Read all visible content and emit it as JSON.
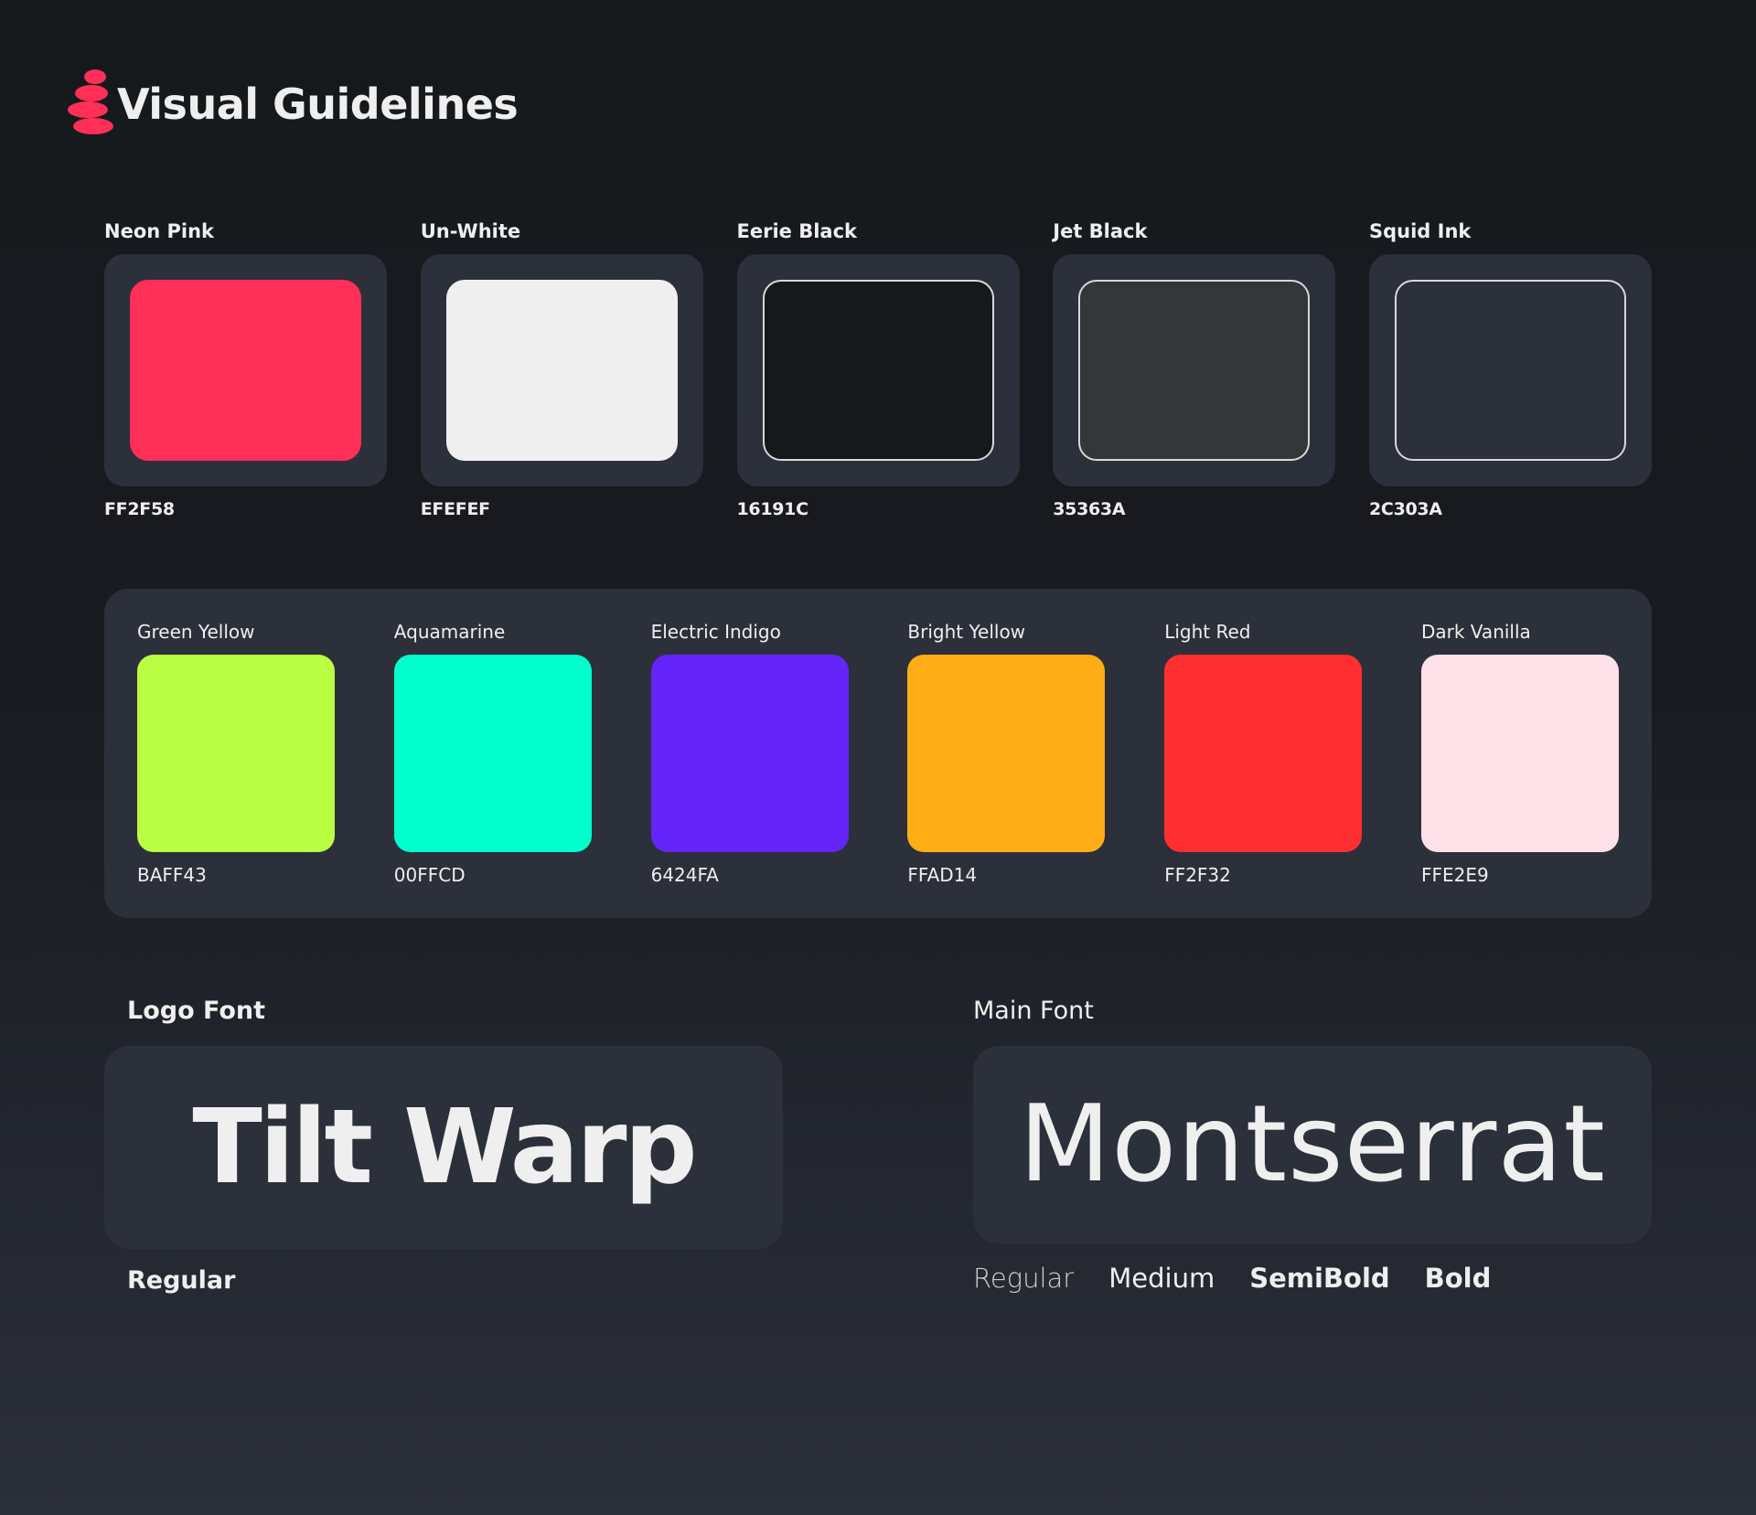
{
  "header": {
    "title": "Visual Guidelines",
    "logo_icon": "stacked-pebbles-icon",
    "accent": "#FF2F58"
  },
  "primary_colors": [
    {
      "name": "Neon Pink",
      "hex": "FF2F58",
      "color": "#FF2F58",
      "outlined": false
    },
    {
      "name": "Un-White",
      "hex": "EFEFEF",
      "color": "#EFEFEF",
      "outlined": false
    },
    {
      "name": "Eerie Black",
      "hex": "16191C",
      "color": "#16191C",
      "outlined": true
    },
    {
      "name": "Jet Black",
      "hex": "35363A",
      "color": "#35363A",
      "outlined": true
    },
    {
      "name": "Squid Ink",
      "hex": "2C303A",
      "color": "#2C303A",
      "outlined": true
    }
  ],
  "secondary_colors": [
    {
      "name": "Green Yellow",
      "hex": "BAFF43",
      "color": "#BAFF43"
    },
    {
      "name": "Aquamarine",
      "hex": "00FFCD",
      "color": "#00FFCD"
    },
    {
      "name": "Electric Indigo",
      "hex": "6424FA",
      "color": "#6424FA"
    },
    {
      "name": "Bright Yellow",
      "hex": "FFAD14",
      "color": "#FFAD14"
    },
    {
      "name": "Light Red",
      "hex": "FF2F32",
      "color": "#FF2F32"
    },
    {
      "name": "Dark Vanilla",
      "hex": "FFE2E9",
      "color": "#FFE2E9"
    }
  ],
  "logo_font": {
    "label": "Logo Font",
    "sample": "Tilt Warp",
    "weights": [
      "Regular"
    ]
  },
  "main_font": {
    "label": "Main Font",
    "sample": "Montserrat",
    "weights": [
      "Regular",
      "Medium",
      "SemiBold",
      "Bold"
    ]
  }
}
